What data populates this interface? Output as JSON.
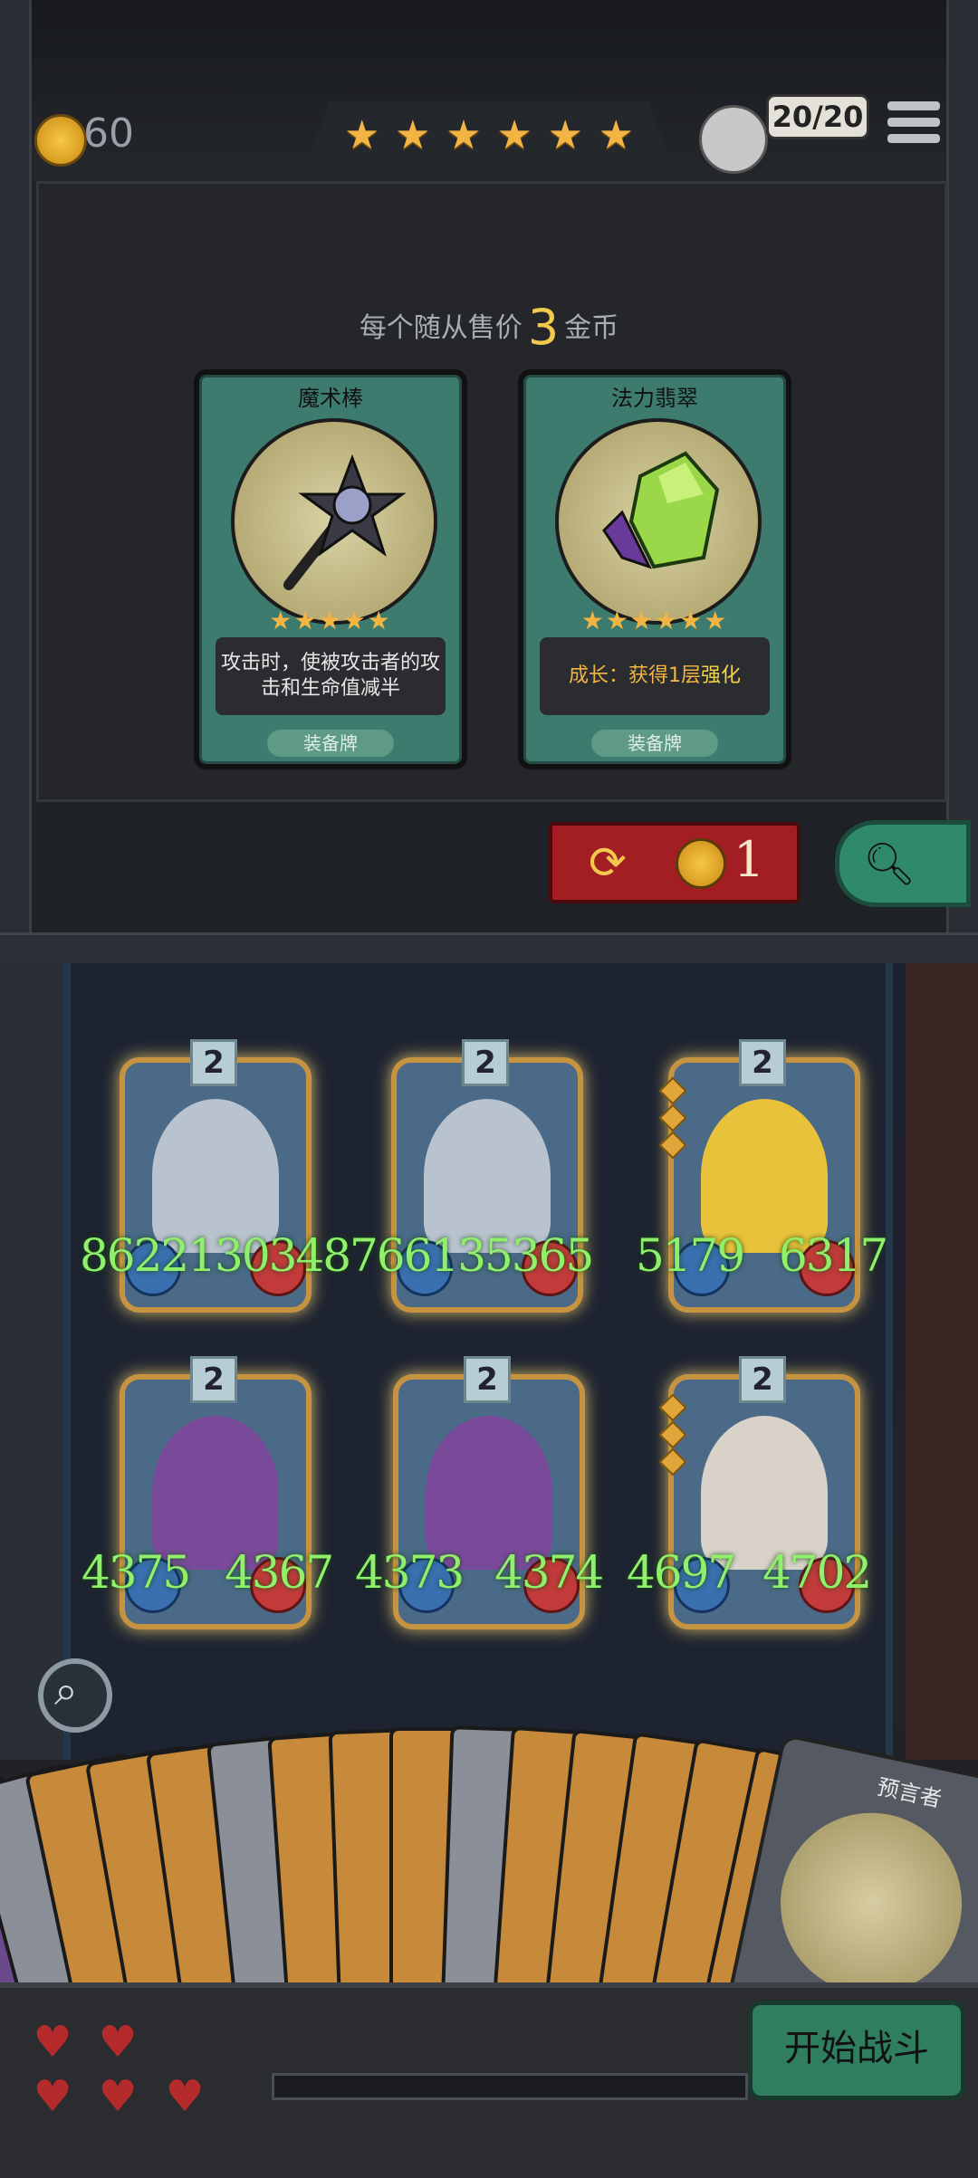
{
  "top_bar": {
    "coins": "60",
    "stars": [
      "★",
      "★",
      "★",
      "★",
      "★",
      "★"
    ],
    "unit_count": "20/20",
    "menu_icon": "hamburger-menu-icon"
  },
  "shop": {
    "sell_text_prefix": "每个随从售价",
    "sell_price": "3",
    "sell_text_suffix": "金币",
    "cards": [
      {
        "title": "魔术棒",
        "stars": "★★★★★",
        "description": "攻击时，使被攻击者的攻击和生命值减半",
        "type": "装备牌"
      },
      {
        "title": "法力翡翠",
        "stars": "★★★★★★",
        "description_prefix": "成长：获得1层",
        "description_highlight": "强化",
        "type": "装备牌"
      }
    ],
    "refresh_cost": "1"
  },
  "board": {
    "minions": [
      {
        "level": "2",
        "attack": "8622130348",
        "health": "",
        "colors": {
          "body": "#b9c3cf",
          "face": "#e7b8b8"
        }
      },
      {
        "level": "2",
        "attack": "766135365",
        "health": "",
        "colors": {
          "body": "#b9c3cf",
          "face": "#e7b8b8"
        }
      },
      {
        "level": "2",
        "attack": "5179",
        "health": "6317",
        "colors": {
          "body": "#e8c23a",
          "face": "#3a3a2a"
        }
      },
      {
        "level": "2",
        "attack": "4375",
        "health": "4367",
        "colors": {
          "body": "#7a4a9a",
          "face": "#d8a888"
        }
      },
      {
        "level": "2",
        "attack": "4373",
        "health": "4374",
        "colors": {
          "body": "#7a4a9a",
          "face": "#d8a888"
        }
      },
      {
        "level": "2",
        "attack": "4697",
        "health": "4702",
        "colors": {
          "body": "#d8d2c8",
          "face": "#e2c49a"
        }
      }
    ]
  },
  "hand": {
    "last_card_name": "预言者",
    "card_count_visible": 20
  },
  "lives": {
    "filled": 5,
    "total": 5
  },
  "start_button": "开始战斗"
}
